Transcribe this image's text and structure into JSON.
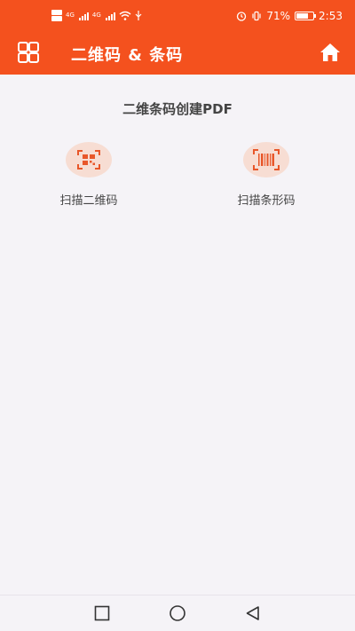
{
  "status_bar": {
    "signal_labels": [
      "4G",
      "4G"
    ],
    "battery_percent": "71%",
    "battery_level": 0.71,
    "time": "2:53"
  },
  "app_bar": {
    "title": "二维码 & 条码",
    "menu_icon": "grid-icon",
    "home_icon": "home-icon"
  },
  "main": {
    "section_title": "二维条码创建PDF",
    "tiles": [
      {
        "label": "扫描二维码",
        "icon": "qr-scan-icon"
      },
      {
        "label": "扫描条形码",
        "icon": "barcode-scan-icon"
      }
    ]
  },
  "nav": {
    "buttons": [
      "recents-icon",
      "home-circle-icon",
      "back-icon"
    ]
  },
  "colors": {
    "primary": "#f4511e",
    "icon_bg": "#f7ddd3",
    "background": "#f5f3f7"
  }
}
